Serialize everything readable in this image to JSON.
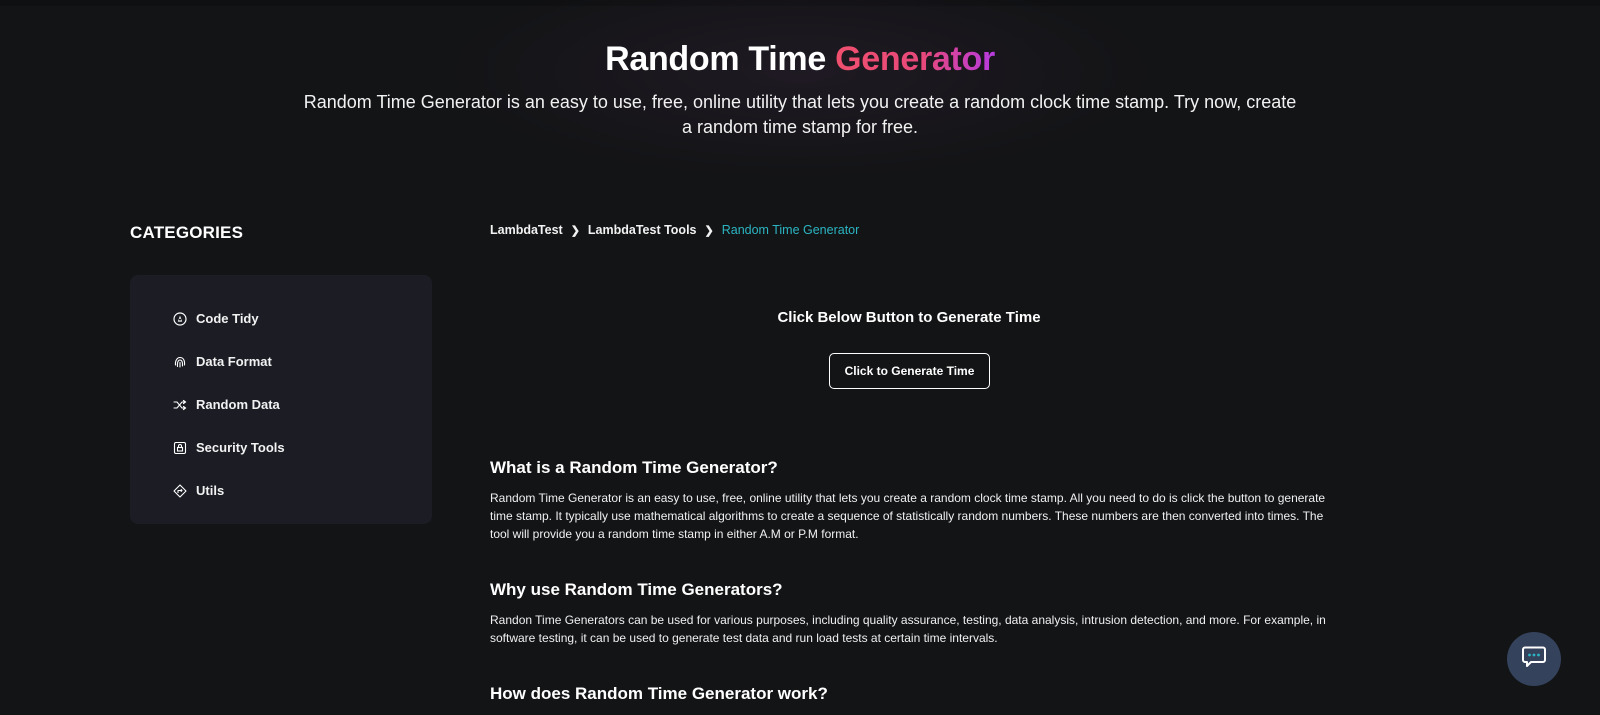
{
  "hero": {
    "title_main": "Random Time",
    "title_accent": "Generator",
    "subtitle": "Random Time Generator is an easy to use, free, online utility that lets you create a random clock time stamp. Try now, create a random time stamp for free."
  },
  "sidebar": {
    "title": "CATEGORIES",
    "items": [
      {
        "label": "Code Tidy",
        "icon": "code-tidy-icon"
      },
      {
        "label": "Data Format",
        "icon": "fingerprint-icon"
      },
      {
        "label": "Random Data",
        "icon": "shuffle-icon"
      },
      {
        "label": "Security Tools",
        "icon": "lock-icon"
      },
      {
        "label": "Utils",
        "icon": "diamond-direction-icon"
      }
    ]
  },
  "breadcrumb": {
    "items": [
      "LambdaTest",
      "LambdaTest Tools"
    ],
    "current": "Random Time Generator"
  },
  "generator": {
    "heading": "Click Below Button to Generate Time",
    "button_label": "Click to Generate Time"
  },
  "sections": [
    {
      "heading": "What is a Random Time Generator?",
      "body": "Random Time Generator is an easy to use, free, online utility that lets you create a random clock time stamp. All you need to do is click the button to generate time stamp. It typically use mathematical algorithms to create a sequence of statistically random numbers. These numbers are then converted into times. The tool will provide you a random time stamp in either A.M or P.M format."
    },
    {
      "heading": "Why use Random Time Generators?",
      "body": "Randon Time Generators can be used for various purposes, including quality assurance, testing, data analysis, intrusion detection, and more. For example, in software testing, it can be used to generate test data and run load tests at certain time intervals."
    },
    {
      "heading": "How does Random Time Generator work?",
      "body": ""
    }
  ],
  "colors": {
    "background": "#131416",
    "card": "#1b1c24",
    "breadcrumb_current": "#2bb5c2",
    "accent_start": "#f0506e",
    "accent_end": "#b73be0",
    "chat_fab": "#34425c"
  },
  "chat": {
    "icon": "chat-icon"
  }
}
